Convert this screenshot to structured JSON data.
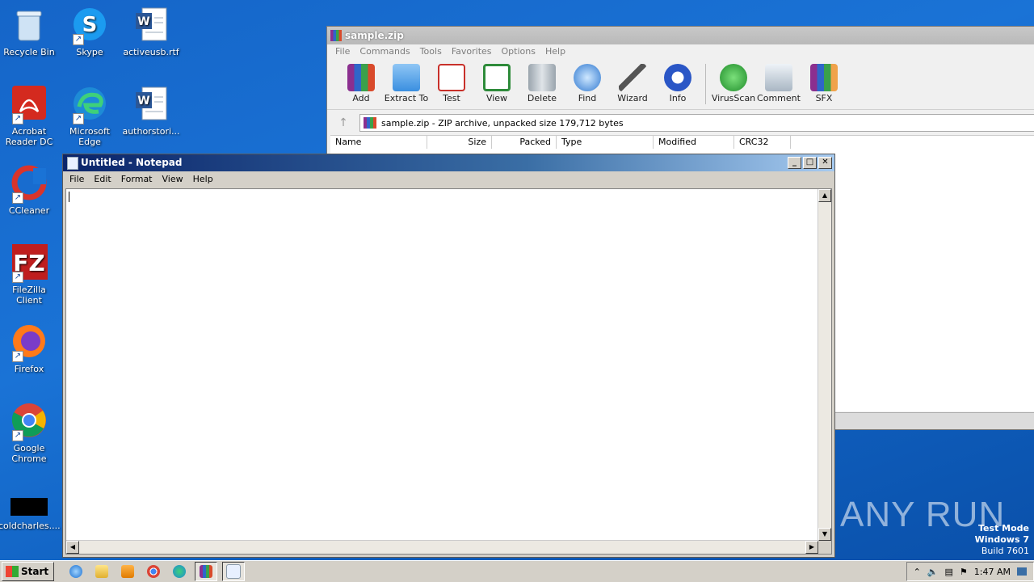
{
  "desktop": {
    "icons": [
      {
        "label": "Recycle Bin"
      },
      {
        "label": "Skype"
      },
      {
        "label": "activeusb.rtf"
      },
      {
        "label": "Acrobat Reader DC"
      },
      {
        "label": "Microsoft Edge"
      },
      {
        "label": "authorstori..."
      },
      {
        "label": "CCleaner"
      },
      {
        "label": "FileZilla Client"
      },
      {
        "label": "Firefox"
      },
      {
        "label": "Google Chrome"
      },
      {
        "label": "coldcharles...."
      }
    ]
  },
  "winrar": {
    "title": "sample.zip",
    "menu": [
      "File",
      "Commands",
      "Tools",
      "Favorites",
      "Options",
      "Help"
    ],
    "toolbar": [
      "Add",
      "Extract To",
      "Test",
      "View",
      "Delete",
      "Find",
      "Wizard",
      "Info",
      "VirusScan",
      "Comment",
      "SFX"
    ],
    "path": "sample.zip - ZIP archive, unpacked size 179,712 bytes",
    "columns": [
      "Name",
      "Size",
      "Packed",
      "Type",
      "Modified",
      "CRC32"
    ]
  },
  "notepad": {
    "title": "Untitled - Notepad",
    "menu": [
      "File",
      "Edit",
      "Format",
      "View",
      "Help"
    ],
    "content": ""
  },
  "watermark": {
    "brand": "ANY RUN",
    "line1": "Test Mode",
    "line2": "Windows 7",
    "line3": "Build 7601"
  },
  "taskbar": {
    "start_label": "Start",
    "clock": "1:47 AM"
  }
}
